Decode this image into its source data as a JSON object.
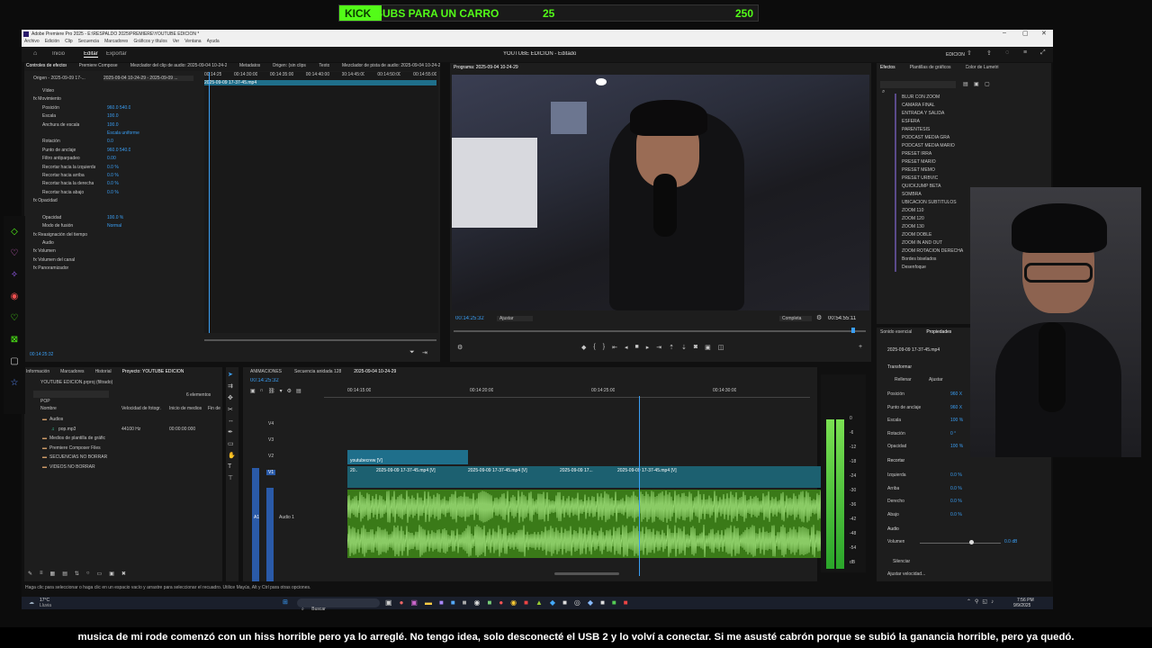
{
  "overlay": {
    "kick_label": "KICK",
    "subs_label": "SUBS PARA UN CARRO",
    "current": "25",
    "goal": "250",
    "progress": 0.1
  },
  "window": {
    "title": "Adobe Premiere Pro 2025 - E:\\RESPALDO 2025\\PREMIERE\\YOUTUBE EDICION *",
    "menu": [
      "Archivo",
      "Edición",
      "Clip",
      "Secuencia",
      "Marcadores",
      "Gráficos y títulos",
      "Ver",
      "Ventana",
      "Ayuda"
    ]
  },
  "header": {
    "tabs": [
      "Inicio",
      "Editar",
      "Exportar"
    ],
    "active": "Editar",
    "project_title": "YOUTUBE EDICION - Editado",
    "workspace": "EDICIÓN"
  },
  "effect_controls": {
    "tabs": [
      "Controles de efectos",
      "Premiere Composer",
      "Mezclador del clip de audio: 2025-09-04 10-24-29",
      "Metadatos",
      "Origen: (sin clips)",
      "Texto",
      "Mezclador de pista de audio: 2025-09-04 10-24-29"
    ],
    "source": "Origen - 2025-09-09 17-...",
    "sequence": "2025-09-04 10-24-29 - 2025-09-09 ...",
    "ruler": [
      "00:14:25",
      "00:14:30:00",
      "00:14:35:00",
      "00:14:40:00",
      "00:14:45:00",
      "00:14:50:00",
      "00:14:55:00"
    ],
    "clip_name": "2025-09-09 17-37-45.mp4",
    "rows": [
      {
        "label": "Vídeo",
        "value": ""
      },
      {
        "label": "fx  Movimiento",
        "value": ""
      },
      {
        "label": "Posición",
        "value": "960.0   540.0"
      },
      {
        "label": "Escala",
        "value": "100.0"
      },
      {
        "label": "Anchura de escala",
        "value": "100.0"
      },
      {
        "label": "",
        "value": "Escala uniforme"
      },
      {
        "label": "Rotación",
        "value": "0.0"
      },
      {
        "label": "Punto de anclaje",
        "value": "960.0   540.0"
      },
      {
        "label": "Filtro antiparpadeo",
        "value": "0.00"
      },
      {
        "label": "Recortar hacia la izquierda",
        "value": "0.0 %"
      },
      {
        "label": "Recortar hacia arriba",
        "value": "0.0 %"
      },
      {
        "label": "Recortar hacia la derecha",
        "value": "0.0 %"
      },
      {
        "label": "Recortar hacia abajo",
        "value": "0.0 %"
      },
      {
        "label": "fx  Opacidad",
        "value": ""
      },
      {
        "label": "",
        "value": ""
      },
      {
        "label": "Opacidad",
        "value": "100.0 %"
      },
      {
        "label": "Modo de fusión",
        "value": "Normal"
      },
      {
        "label": "fx  Reasignación del tiempo",
        "value": ""
      },
      {
        "label": "Audio",
        "value": ""
      },
      {
        "label": "fx  Volumen",
        "value": ""
      },
      {
        "label": "fx  Volumen del canal",
        "value": ""
      },
      {
        "label": "fx  Panoramizador",
        "value": ""
      }
    ],
    "timecode": "00:14:25:32"
  },
  "program": {
    "label": "Programa: 2025-09-04 10-24-29",
    "timecode": "00:14:25:32",
    "fit": "Ajustar",
    "quality": "Completa",
    "duration": "00:54:55:11"
  },
  "effects_panel": {
    "tabs": [
      "Efectos",
      "Plantillas de gráficos",
      "Color de Lumetri"
    ],
    "items": [
      "BLUR CON ZOOM",
      "CAMARA FINAL",
      "ENTRADA Y SALIDA",
      "ESFERA",
      "PARENTESIS",
      "PODCAST MEDIA GRA",
      "PODCAST MEDIA MARIO",
      "PRESET IRRA",
      "PRESET MARIO",
      "PRESET MEMO",
      "PRESET URBVIC",
      "QUICKJUMP BETA",
      "SOMBRA",
      "UBICACION SUBTITULOS",
      "ZOOM 110",
      "ZOOM 120",
      "ZOOM 130",
      "ZOOM DOBLE",
      "ZOOM IN AND OUT",
      "ZOOM ROTACION DERECHA",
      "Bordes biselados",
      "Desenfoque"
    ]
  },
  "properties": {
    "tabs": [
      "Sonido esencial",
      "Propiedades"
    ],
    "clip": "2025-09-09 17-37-45.mp4",
    "transform": "Transformar",
    "fill": "Rellenar",
    "fit": "Ajustar",
    "rows": [
      {
        "label": "Posición",
        "value": "960 X"
      },
      {
        "label": "Punto de anclaje",
        "value": "960 X"
      },
      {
        "label": "Escala",
        "value": "100 %"
      },
      {
        "label": "Rotación",
        "value": "0 °"
      },
      {
        "label": "Opacidad",
        "value": "100 %"
      }
    ],
    "crop": "Recortar",
    "crop_rows": [
      {
        "label": "Izquierda",
        "value": "0.0 %"
      },
      {
        "label": "Arriba",
        "value": "0.0 %"
      },
      {
        "label": "Derecho",
        "value": "0.0 %"
      },
      {
        "label": "Abajo",
        "value": "0.0 %"
      }
    ],
    "audio": "Audio",
    "volume_label": "Volumen",
    "volume_value": "0.0 dB",
    "mute": "Silenciar",
    "speed": "Ajustar velocidad..."
  },
  "project": {
    "tabs": [
      "Información",
      "Marcadores",
      "Historial",
      "Proyecto: YOUTUBE EDICION"
    ],
    "file": "YOUTUBE EDICION.prproj (filtrado)",
    "search": "POP",
    "count": "6 elementos",
    "columns": [
      "Nombre",
      "Velocidad de fotogr.",
      "Inicio de medios",
      "Fin de"
    ],
    "rows": [
      {
        "name": "Audios",
        "fps": "",
        "start": ""
      },
      {
        "name": "pop.mp3",
        "fps": "44100 Hz",
        "start": "00:00:00:000"
      },
      {
        "name": "Medios de plantilla de gráfic",
        "fps": "",
        "start": ""
      },
      {
        "name": "Premiere Composer Files",
        "fps": "",
        "start": ""
      },
      {
        "name": "SECUENCIAS NO BORRAR",
        "fps": "",
        "start": ""
      },
      {
        "name": "VIDEOS NO BORRAR",
        "fps": "",
        "start": ""
      }
    ]
  },
  "timeline": {
    "tabs": [
      "ANIMACIONES",
      "Secuencia anidada 128",
      "2025-09-04 10-24-29"
    ],
    "timecode": "00:14:25:32",
    "ruler": [
      "00:14:15:00",
      "00:14:20:00",
      "00:14:25:00",
      "00:14:30:00"
    ],
    "tracks": [
      "V4",
      "V3",
      "V2",
      "V1",
      "A1"
    ],
    "audio_track_name": "Audio 1",
    "nested": "youtubecrew [V]",
    "clips": [
      "20..",
      "2025-09-09 17-37-45.mp4 [V]",
      "2025-09-09 17-37-45.mp4 [V]",
      "2025-09-09 17...",
      "2025-09-09 17-37-45.mp4 [V]"
    ]
  },
  "meter": {
    "labels": [
      "0",
      "-6",
      "-12",
      "-18",
      "-24",
      "-30",
      "-36",
      "-42",
      "-48",
      "-54",
      "dB"
    ]
  },
  "status_bar": "Haga clic para seleccionar o haga clic en un espacio vacío y arrastre para seleccionar el recuadro. Utilice Mayús, Alt y Ctrl para otras opciones.",
  "taskbar": {
    "weather": "17°C",
    "weather_desc": "Lluvia",
    "search": "Buscar",
    "time": "7:56 PM",
    "date": "9/9/2025"
  },
  "caption": "musica de mi rode comenzó con un hiss horrible pero ya lo arreglé.  No tengo idea, solo desconecté el USB 2 y lo volví a conectar.  Si me asusté cabrón porque se subió la ganancia horrible, pero ya quedó."
}
